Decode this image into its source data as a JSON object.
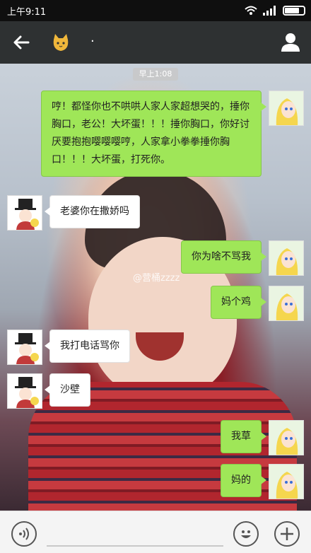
{
  "status_bar": {
    "time": "上午9:11"
  },
  "header": {
    "name": "·",
    "avatar_icon": "cat-avatar"
  },
  "chat": {
    "timestamp": "早上1:08",
    "watermark": "@营桶zzzz",
    "messages": [
      {
        "from": "me",
        "text": "哼！都怪你也不哄哄人家人家超想哭的，捶你胸口，老公！大坏蛋！！！捶你胸口，你好讨厌要抱抱嘤嘤嘤哼，人家拿小拳拳捶你胸口！！！大坏蛋，打死你。"
      },
      {
        "from": "them",
        "text": "老婆你在撒娇吗"
      },
      {
        "from": "me",
        "text": "你为啥不骂我"
      },
      {
        "from": "me",
        "text": "妈个鸡"
      },
      {
        "from": "them",
        "text": "我打电话骂你"
      },
      {
        "from": "them",
        "text": "沙壁"
      },
      {
        "from": "me",
        "text": "我草"
      },
      {
        "from": "me",
        "text": "妈的"
      }
    ]
  },
  "input_bar": {
    "voice_icon": "voice-icon",
    "emoji_icon": "emoji-icon",
    "plus_icon": "plus-icon"
  }
}
